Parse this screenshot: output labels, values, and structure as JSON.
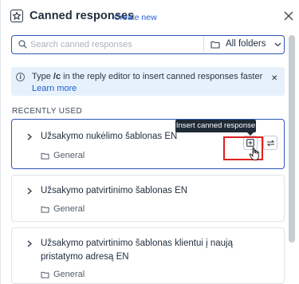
{
  "header": {
    "title": "Canned responses",
    "create_link": "Create new"
  },
  "search": {
    "placeholder": "Search canned responses",
    "value": "",
    "folder_selected": "All folders"
  },
  "info_banner": {
    "text_before": "Type ",
    "shortcut": "/c",
    "text_after": " in the reply editor to insert canned responses faster",
    "link": "Learn more",
    "close": "✕"
  },
  "section_label": "RECENTLY USED",
  "tooltip": "Insert canned response",
  "responses": [
    {
      "title": "Užsakymo nukėlimo šablonas EN",
      "folder": "General"
    },
    {
      "title": "Užsakymo patvirtinimo šablonas EN",
      "folder": "General"
    },
    {
      "title": "Užsakymo patvirtinimo šablonas klientui į naują pristatymo adresą EN",
      "folder": "General"
    }
  ],
  "colors": {
    "accent": "#2f56b8",
    "link": "#1f60d6",
    "info_bg": "#e6f1fb",
    "highlight": "#e02020"
  },
  "icons": [
    "canned-responses-icon",
    "close-icon",
    "search-icon",
    "folder-icon",
    "chevron-down-icon",
    "info-icon",
    "chevron-right-icon",
    "insert-icon",
    "swap-icon",
    "hand-cursor-icon"
  ]
}
